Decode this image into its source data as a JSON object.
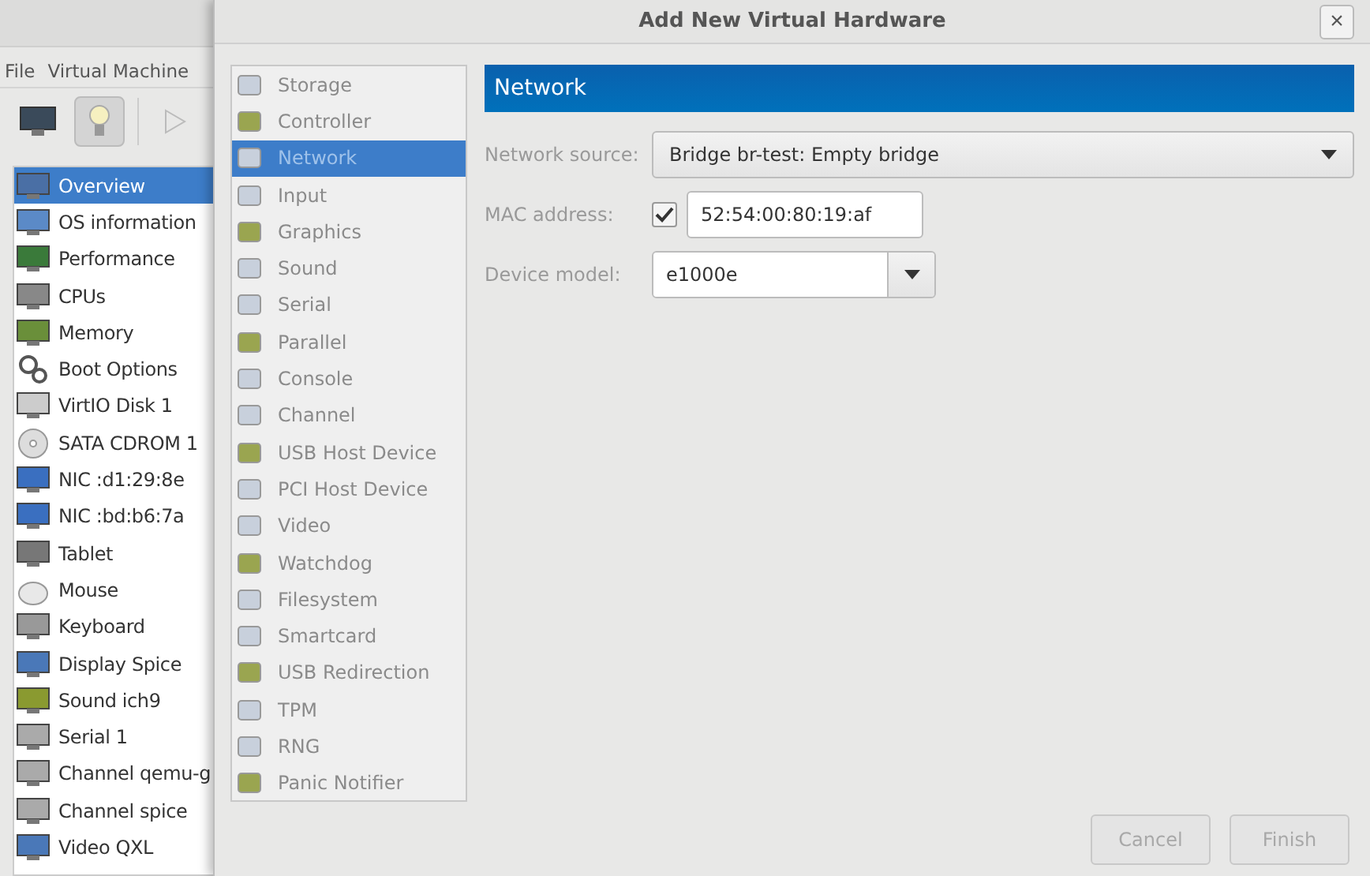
{
  "background_window": {
    "menu": [
      "File",
      "Virtual Machine"
    ],
    "toolbar": [
      {
        "selected": false
      },
      {
        "selected": true
      },
      {
        "selected": false
      }
    ],
    "hardware_list": [
      {
        "label": "Overview",
        "selected": true
      },
      {
        "label": "OS information",
        "selected": false
      },
      {
        "label": "Performance",
        "selected": false
      },
      {
        "label": "CPUs",
        "selected": false
      },
      {
        "label": "Memory",
        "selected": false
      },
      {
        "label": "Boot Options",
        "selected": false
      },
      {
        "label": "VirtIO Disk 1",
        "selected": false
      },
      {
        "label": "SATA CDROM 1",
        "selected": false
      },
      {
        "label": "NIC :d1:29:8e",
        "selected": false
      },
      {
        "label": "NIC :bd:b6:7a",
        "selected": false
      },
      {
        "label": "Tablet",
        "selected": false
      },
      {
        "label": "Mouse",
        "selected": false
      },
      {
        "label": "Keyboard",
        "selected": false
      },
      {
        "label": "Display Spice",
        "selected": false
      },
      {
        "label": "Sound ich9",
        "selected": false
      },
      {
        "label": "Serial 1",
        "selected": false
      },
      {
        "label": "Channel qemu-g",
        "selected": false
      },
      {
        "label": "Channel spice",
        "selected": false
      },
      {
        "label": "Video QXL",
        "selected": false
      }
    ]
  },
  "dialog": {
    "title": "Add New Virtual Hardware",
    "close": "×",
    "categories": [
      {
        "label": "Storage",
        "selected": false
      },
      {
        "label": "Controller",
        "selected": false
      },
      {
        "label": "Network",
        "selected": true
      },
      {
        "label": "Input",
        "selected": false
      },
      {
        "label": "Graphics",
        "selected": false
      },
      {
        "label": "Sound",
        "selected": false
      },
      {
        "label": "Serial",
        "selected": false
      },
      {
        "label": "Parallel",
        "selected": false
      },
      {
        "label": "Console",
        "selected": false
      },
      {
        "label": "Channel",
        "selected": false
      },
      {
        "label": "USB Host Device",
        "selected": false
      },
      {
        "label": "PCI Host Device",
        "selected": false
      },
      {
        "label": "Video",
        "selected": false
      },
      {
        "label": "Watchdog",
        "selected": false
      },
      {
        "label": "Filesystem",
        "selected": false
      },
      {
        "label": "Smartcard",
        "selected": false
      },
      {
        "label": "USB Redirection",
        "selected": false
      },
      {
        "label": "TPM",
        "selected": false
      },
      {
        "label": "RNG",
        "selected": false
      },
      {
        "label": "Panic Notifier",
        "selected": false
      }
    ],
    "header": "Network",
    "network_source": {
      "label": "Network source:",
      "value": "Bridge br-test: Empty bridge"
    },
    "mac_address": {
      "label": "MAC address:",
      "checked": true,
      "value": "52:54:00:80:19:af"
    },
    "device_model": {
      "label": "Device model:",
      "value": "e1000e"
    },
    "buttons": [
      {
        "label": "Cancel",
        "disabled": true
      },
      {
        "label": "Finish",
        "disabled": true
      }
    ]
  }
}
